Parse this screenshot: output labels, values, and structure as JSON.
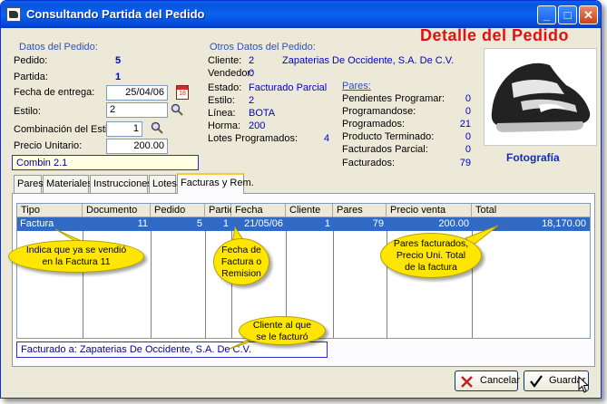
{
  "window": {
    "title": "Consultando Partida del Pedido",
    "header": "Detalle del  Pedido"
  },
  "datos_pedido": {
    "section": "Datos del Pedido:",
    "pedido_label": "Pedido:",
    "pedido": "5",
    "partida_label": "Partida:",
    "partida": "1",
    "fecha_label": "Fecha de entrega:",
    "fecha": "25/04/06",
    "estilo_label": "Estilo:",
    "estilo": "2",
    "combinacion_label": "Combinación del Estilo:",
    "combinacion": "1",
    "precio_label": "Precio Unitario:",
    "precio": "200.00",
    "combin_text": "Combin 2.1"
  },
  "otros_datos": {
    "section": "Otros Datos del Pedido:",
    "cliente_label": "Cliente:",
    "cliente_num": "2",
    "cliente_nombre": "Zapaterias De Occidente, S.A. De C.V.",
    "vendedor_label": "Vendedor:",
    "vendedor": "0",
    "estado_label": "Estado:",
    "estado": "Facturado Parcial",
    "estilo_label": "Estilo:",
    "estilo": "2",
    "linea_label": "Línea:",
    "linea": "BOTA",
    "horma_label": "Horma:",
    "horma": "200",
    "lotes_label": "Lotes Programados:",
    "lotes": "4"
  },
  "pares": {
    "section": "Pares:",
    "items": [
      {
        "label": "Pendientes Programar:",
        "value": "0"
      },
      {
        "label": "Programandose:",
        "value": "0"
      },
      {
        "label": "Programados:",
        "value": "21"
      },
      {
        "label": "Producto Terminado:",
        "value": "0"
      },
      {
        "label": "Facturados Parcial:",
        "value": "0"
      },
      {
        "label": "Facturados:",
        "value": "79"
      }
    ]
  },
  "photo": {
    "caption": "Fotografía"
  },
  "tabs": [
    {
      "label": "Pares"
    },
    {
      "label": "Materiales"
    },
    {
      "label": "Instrucciones"
    },
    {
      "label": "Lotes"
    },
    {
      "label": "Facturas y Rem."
    }
  ],
  "grid": {
    "headers": [
      "Tipo",
      "Documento",
      "Pedido",
      "Partid",
      "Fecha",
      "Cliente",
      "Pares",
      "Precio venta",
      "Total"
    ],
    "row": [
      "Factura",
      "11",
      "5",
      "1",
      "21/05/06",
      "1",
      "79",
      "200.00",
      "18,170.00"
    ]
  },
  "footer": {
    "facturado": "Facturado a:  Zapaterias De Occidente, S.A. De C.V."
  },
  "buttons": {
    "cancelar": "Cancelar",
    "guardar": "Guardar"
  },
  "callouts": {
    "c1": [
      "Indica que ya se vendió",
      "en la Factura 11"
    ],
    "c2": [
      "Fecha de",
      "Factura o",
      "Remision"
    ],
    "c3": [
      "Pares facturados,",
      "Precio Uni. Total",
      "de la factura"
    ],
    "c4": [
      "Cliente al que",
      "se le facturó"
    ]
  },
  "colors": {
    "accent_red": "#e31010",
    "value_blue": "#0000cc",
    "selection": "#316ac5",
    "callout": "#ffe600"
  }
}
